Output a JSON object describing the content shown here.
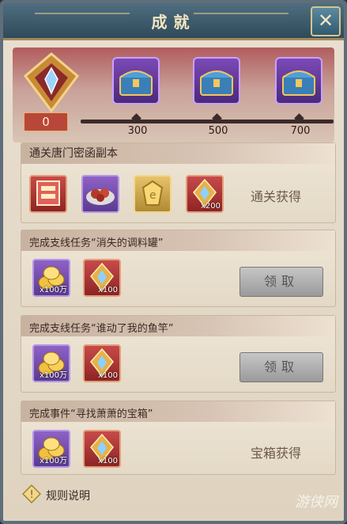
{
  "window": {
    "title": "成就",
    "close_icon": "close-icon"
  },
  "progress": {
    "current": "0",
    "tiers": [
      {
        "value": "300",
        "icon": "treasure-chest-icon"
      },
      {
        "value": "500",
        "icon": "treasure-chest-icon"
      },
      {
        "value": "700",
        "icon": "treasure-chest-icon"
      }
    ]
  },
  "achievements": [
    {
      "title": "通关唐门密函副本",
      "items": [
        {
          "icon": "seal-item-icon",
          "qty": ""
        },
        {
          "icon": "food-plate-icon",
          "qty": ""
        },
        {
          "icon": "gold-token-icon",
          "qty": ""
        },
        {
          "icon": "crystal-emblem-icon",
          "qty": "x200"
        }
      ],
      "status": "通关获得"
    },
    {
      "title": "完成支线任务“消失的调料罐”",
      "items": [
        {
          "icon": "gold-coins-icon",
          "qty": "x100万"
        },
        {
          "icon": "crystal-emblem-icon",
          "qty": "x100"
        }
      ],
      "button": "领取"
    },
    {
      "title": "完成支线任务“谁动了我的鱼竿”",
      "items": [
        {
          "icon": "gold-coins-icon",
          "qty": "x100万"
        },
        {
          "icon": "crystal-emblem-icon",
          "qty": "x100"
        }
      ],
      "button": "领取"
    },
    {
      "title": "完成事件“寻找萧萧的宝箱”",
      "items": [
        {
          "icon": "gold-coins-icon",
          "qty": "x100万"
        },
        {
          "icon": "crystal-emblem-icon",
          "qty": "x100"
        }
      ],
      "status": "宝箱获得"
    }
  ],
  "footer": {
    "rules_label": "规则说明",
    "watermark": "游侠网"
  },
  "colors": {
    "accent_gold": "#d9a64a",
    "title_bar": "#2f4a5a",
    "banner_red": "#b15d5d"
  }
}
